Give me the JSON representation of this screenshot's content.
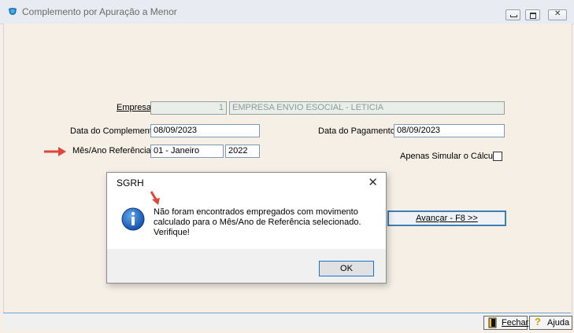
{
  "window": {
    "title": "Complemento por Apuração a Menor"
  },
  "form": {
    "empresa_label": "Empresa",
    "empresa_code": "1",
    "empresa_name": "EMPRESA ENVIO ESOCIAL - LETICIA",
    "data_complemento_label": "Data do Complemento",
    "data_complemento_value": "08/09/2023",
    "data_pagamento_label": "Data do Pagamento",
    "data_pagamento_value": "08/09/2023",
    "mes_ano_label": "Mês/Ano Referência",
    "mes_value": "01 - Janeiro",
    "ano_value": "2022",
    "simular_label": "Apenas Simular o Cálculo",
    "simular_checked": false,
    "advance_label": "Avançar - F8 >>"
  },
  "dialog": {
    "title": "SGRH",
    "message_line1": "Não foram encontrados empregados com movimento",
    "message_line2": "calculado para o Mês/Ano de Referência selecionado.",
    "message_line3": "Verifique!",
    "ok_label": "OK",
    "close_icon": "close-icon",
    "info_icon": "info-icon"
  },
  "bottom": {
    "fechar_label": "Fechar",
    "ajuda_label": "Ajuda"
  },
  "colors": {
    "annotation_arrow": "#e0463a",
    "accent": "#3c7fb1"
  }
}
